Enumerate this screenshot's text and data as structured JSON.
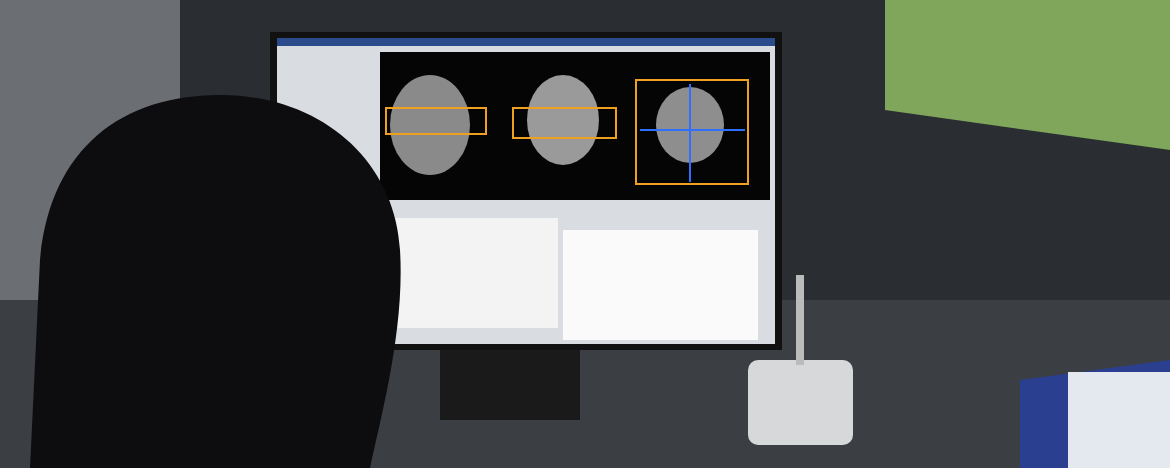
{
  "photo": {
    "kind": "photograph"
  }
}
